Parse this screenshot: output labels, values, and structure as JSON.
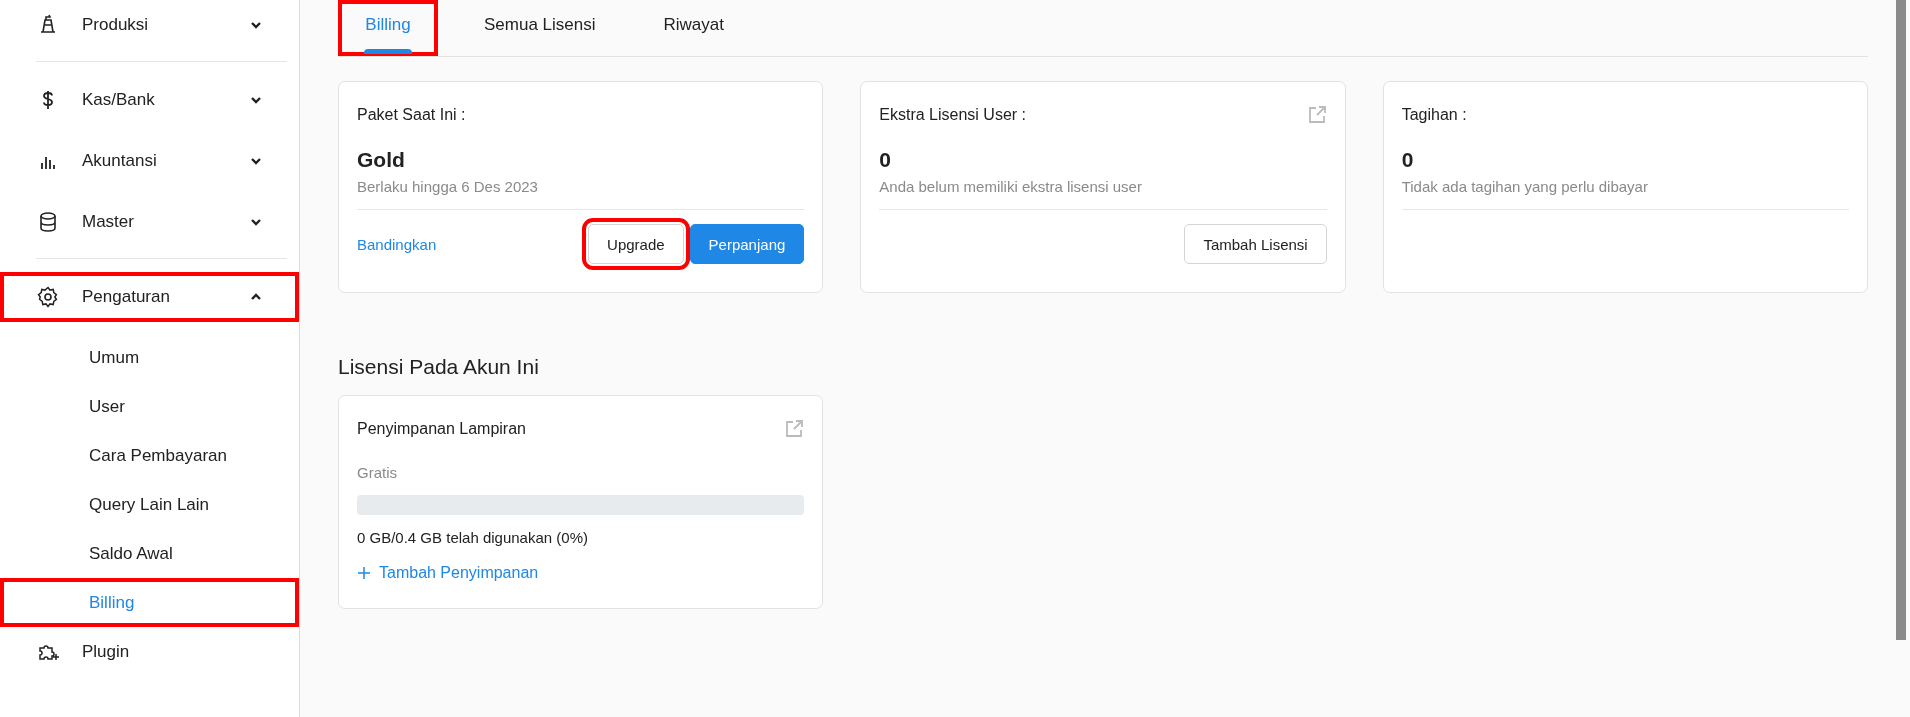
{
  "sidebar": {
    "items": [
      {
        "kind": "group",
        "label": "Produksi",
        "expanded": false,
        "highlighted": false
      },
      {
        "kind": "divider"
      },
      {
        "kind": "group",
        "label": "Kas/Bank",
        "expanded": false,
        "highlighted": false
      },
      {
        "kind": "group",
        "label": "Akuntansi",
        "expanded": false,
        "highlighted": false
      },
      {
        "kind": "group",
        "label": "Master",
        "expanded": false,
        "highlighted": false
      },
      {
        "kind": "divider"
      },
      {
        "kind": "group",
        "label": "Pengaturan",
        "expanded": true,
        "highlighted": true,
        "children": [
          {
            "label": "Umum",
            "selected": false,
            "highlighted": false
          },
          {
            "label": "User",
            "selected": false,
            "highlighted": false
          },
          {
            "label": "Cara Pembayaran",
            "selected": false,
            "highlighted": false
          },
          {
            "label": "Query Lain Lain",
            "selected": false,
            "highlighted": false
          },
          {
            "label": "Saldo Awal",
            "selected": false,
            "highlighted": false
          },
          {
            "label": "Billing",
            "selected": true,
            "highlighted": true
          }
        ]
      },
      {
        "kind": "link",
        "label": "Plugin",
        "highlighted": false
      }
    ]
  },
  "tabs": [
    {
      "label": "Billing",
      "selected": true,
      "highlighted": true
    },
    {
      "label": "Semua Lisensi",
      "selected": false,
      "highlighted": false
    },
    {
      "label": "Riwayat",
      "selected": false,
      "highlighted": false
    }
  ],
  "cards": [
    {
      "title": "Paket Saat Ini :",
      "open_icon": false,
      "value": "Gold",
      "note": "Berlaku hingga 6 Des 2023",
      "link": "Bandingkan",
      "buttons": [
        {
          "label": "Upgrade",
          "kind": "outline",
          "highlighted": true
        },
        {
          "label": "Perpanjang",
          "kind": "primary",
          "highlighted": false
        }
      ]
    },
    {
      "title": "Ekstra Lisensi User :",
      "open_icon": true,
      "value": "0",
      "note": "Anda belum memiliki ekstra lisensi user",
      "buttons": [
        {
          "label": "Tambah Lisensi",
          "kind": "outline",
          "highlighted": false
        }
      ]
    },
    {
      "title": "Tagihan :",
      "open_icon": false,
      "value": "0",
      "note": "Tidak ada tagihan yang perlu dibayar"
    }
  ],
  "licenses": {
    "heading": "Lisensi Pada Akun Ini",
    "items": [
      {
        "title": "Penyimpanan Lampiran",
        "open_icon": true,
        "plan": "Gratis",
        "level": 0,
        "usage": "0 GB/0.4 GB telah digunakan (0%)",
        "action": "Tambah Penyimpanan"
      }
    ]
  }
}
